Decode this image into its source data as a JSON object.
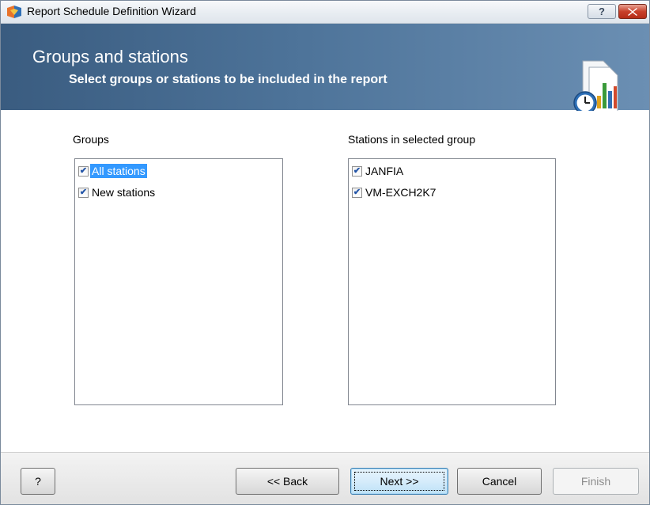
{
  "window": {
    "title": "Report Schedule Definition Wizard",
    "help_button": "?",
    "close_button": "x"
  },
  "banner": {
    "title": "Groups and stations",
    "subtitle": "Select groups or stations to be included in the report",
    "background_color": "#4d7399"
  },
  "groups": {
    "label": "Groups",
    "items": [
      {
        "label": "All stations",
        "checked": true,
        "selected": true
      },
      {
        "label": "New stations",
        "checked": true,
        "selected": false
      }
    ]
  },
  "stations": {
    "label": "Stations in selected group",
    "items": [
      {
        "label": "JANFIA",
        "checked": true,
        "selected": false
      },
      {
        "label": "VM-EXCH2K7",
        "checked": true,
        "selected": false
      }
    ]
  },
  "footer": {
    "help_label": "?",
    "back_label": "<< Back",
    "next_label": "Next >>",
    "cancel_label": "Cancel",
    "finish_label": "Finish"
  },
  "colors": {
    "selection": "#3399ff",
    "checkmark": "#2355a8"
  }
}
